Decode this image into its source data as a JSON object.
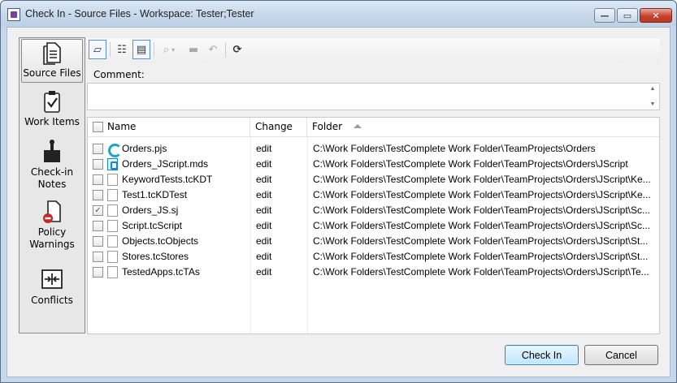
{
  "window": {
    "title": "Check In - Source Files - Workspace: Tester;Tester",
    "controls": {
      "minimize": "—",
      "maximize": "▭",
      "close": "✕"
    }
  },
  "nav": {
    "items": [
      {
        "label": "Source Files",
        "icon": "source-files-icon",
        "selected": true
      },
      {
        "label": "Work Items",
        "icon": "work-items-icon",
        "selected": false
      },
      {
        "label": "Check-in Notes",
        "line1": "Check-in",
        "line2": "Notes",
        "icon": "check-in-notes-icon",
        "selected": false
      },
      {
        "label": "Policy Warnings",
        "line1": "Policy",
        "line2": "Warnings",
        "icon": "policy-warnings-icon",
        "selected": false
      },
      {
        "label": "Conflicts",
        "icon": "conflicts-icon",
        "selected": false
      }
    ]
  },
  "toolbar": {
    "buttons": [
      {
        "icon": "comment-icon",
        "glyph": "▱"
      },
      {
        "icon": "tree-view-icon",
        "glyph": "☷"
      },
      {
        "icon": "list-view-icon",
        "glyph": "▤"
      },
      {
        "icon": "compare-icon",
        "glyph": "⌕"
      },
      {
        "icon": "history-icon",
        "glyph": "▬"
      },
      {
        "icon": "undo-icon",
        "glyph": "↶"
      },
      {
        "icon": "refresh-icon",
        "glyph": "⟳"
      }
    ]
  },
  "comment": {
    "label": "Comment:",
    "value": ""
  },
  "table": {
    "columns": {
      "name": "Name",
      "change": "Change",
      "folder": "Folder"
    },
    "rows": [
      {
        "name": "Orders.pjs",
        "change": "edit",
        "folder": "C:\\Work Folders\\TestComplete Work Folder\\TeamProjects\\Orders",
        "checked": false,
        "icon": "project-suite-icon"
      },
      {
        "name": "Orders_JScript.mds",
        "change": "edit",
        "folder": "C:\\Work Folders\\TestComplete Work Folder\\TeamProjects\\Orders\\JScript",
        "checked": false,
        "icon": "project-icon"
      },
      {
        "name": "KeywordTests.tcKDT",
        "change": "edit",
        "folder": "C:\\Work Folders\\TestComplete Work Folder\\TeamProjects\\Orders\\JScript\\Ke...",
        "checked": false,
        "icon": "file-icon"
      },
      {
        "name": "Test1.tcKDTest",
        "change": "edit",
        "folder": "C:\\Work Folders\\TestComplete Work Folder\\TeamProjects\\Orders\\JScript\\Ke...",
        "checked": false,
        "icon": "file-icon"
      },
      {
        "name": "Orders_JS.sj",
        "change": "edit",
        "folder": "C:\\Work Folders\\TestComplete Work Folder\\TeamProjects\\Orders\\JScript\\Sc...",
        "checked": true,
        "icon": "file-icon"
      },
      {
        "name": "Script.tcScript",
        "change": "edit",
        "folder": "C:\\Work Folders\\TestComplete Work Folder\\TeamProjects\\Orders\\JScript\\Sc...",
        "checked": false,
        "icon": "file-icon"
      },
      {
        "name": "Objects.tcObjects",
        "change": "edit",
        "folder": "C:\\Work Folders\\TestComplete Work Folder\\TeamProjects\\Orders\\JScript\\St...",
        "checked": false,
        "icon": "file-icon"
      },
      {
        "name": "Stores.tcStores",
        "change": "edit",
        "folder": "C:\\Work Folders\\TestComplete Work Folder\\TeamProjects\\Orders\\JScript\\St...",
        "checked": false,
        "icon": "file-icon"
      },
      {
        "name": "TestedApps.tcTAs",
        "change": "edit",
        "folder": "C:\\Work Folders\\TestComplete Work Folder\\TeamProjects\\Orders\\JScript\\Te...",
        "checked": false,
        "icon": "file-icon"
      }
    ]
  },
  "buttons": {
    "check_in": "Check In",
    "cancel": "Cancel"
  },
  "checkmark": "✓",
  "colors": {
    "accent": "#3c7fb1",
    "window_frame": "#c6d7ea",
    "close": "#c6422c"
  }
}
